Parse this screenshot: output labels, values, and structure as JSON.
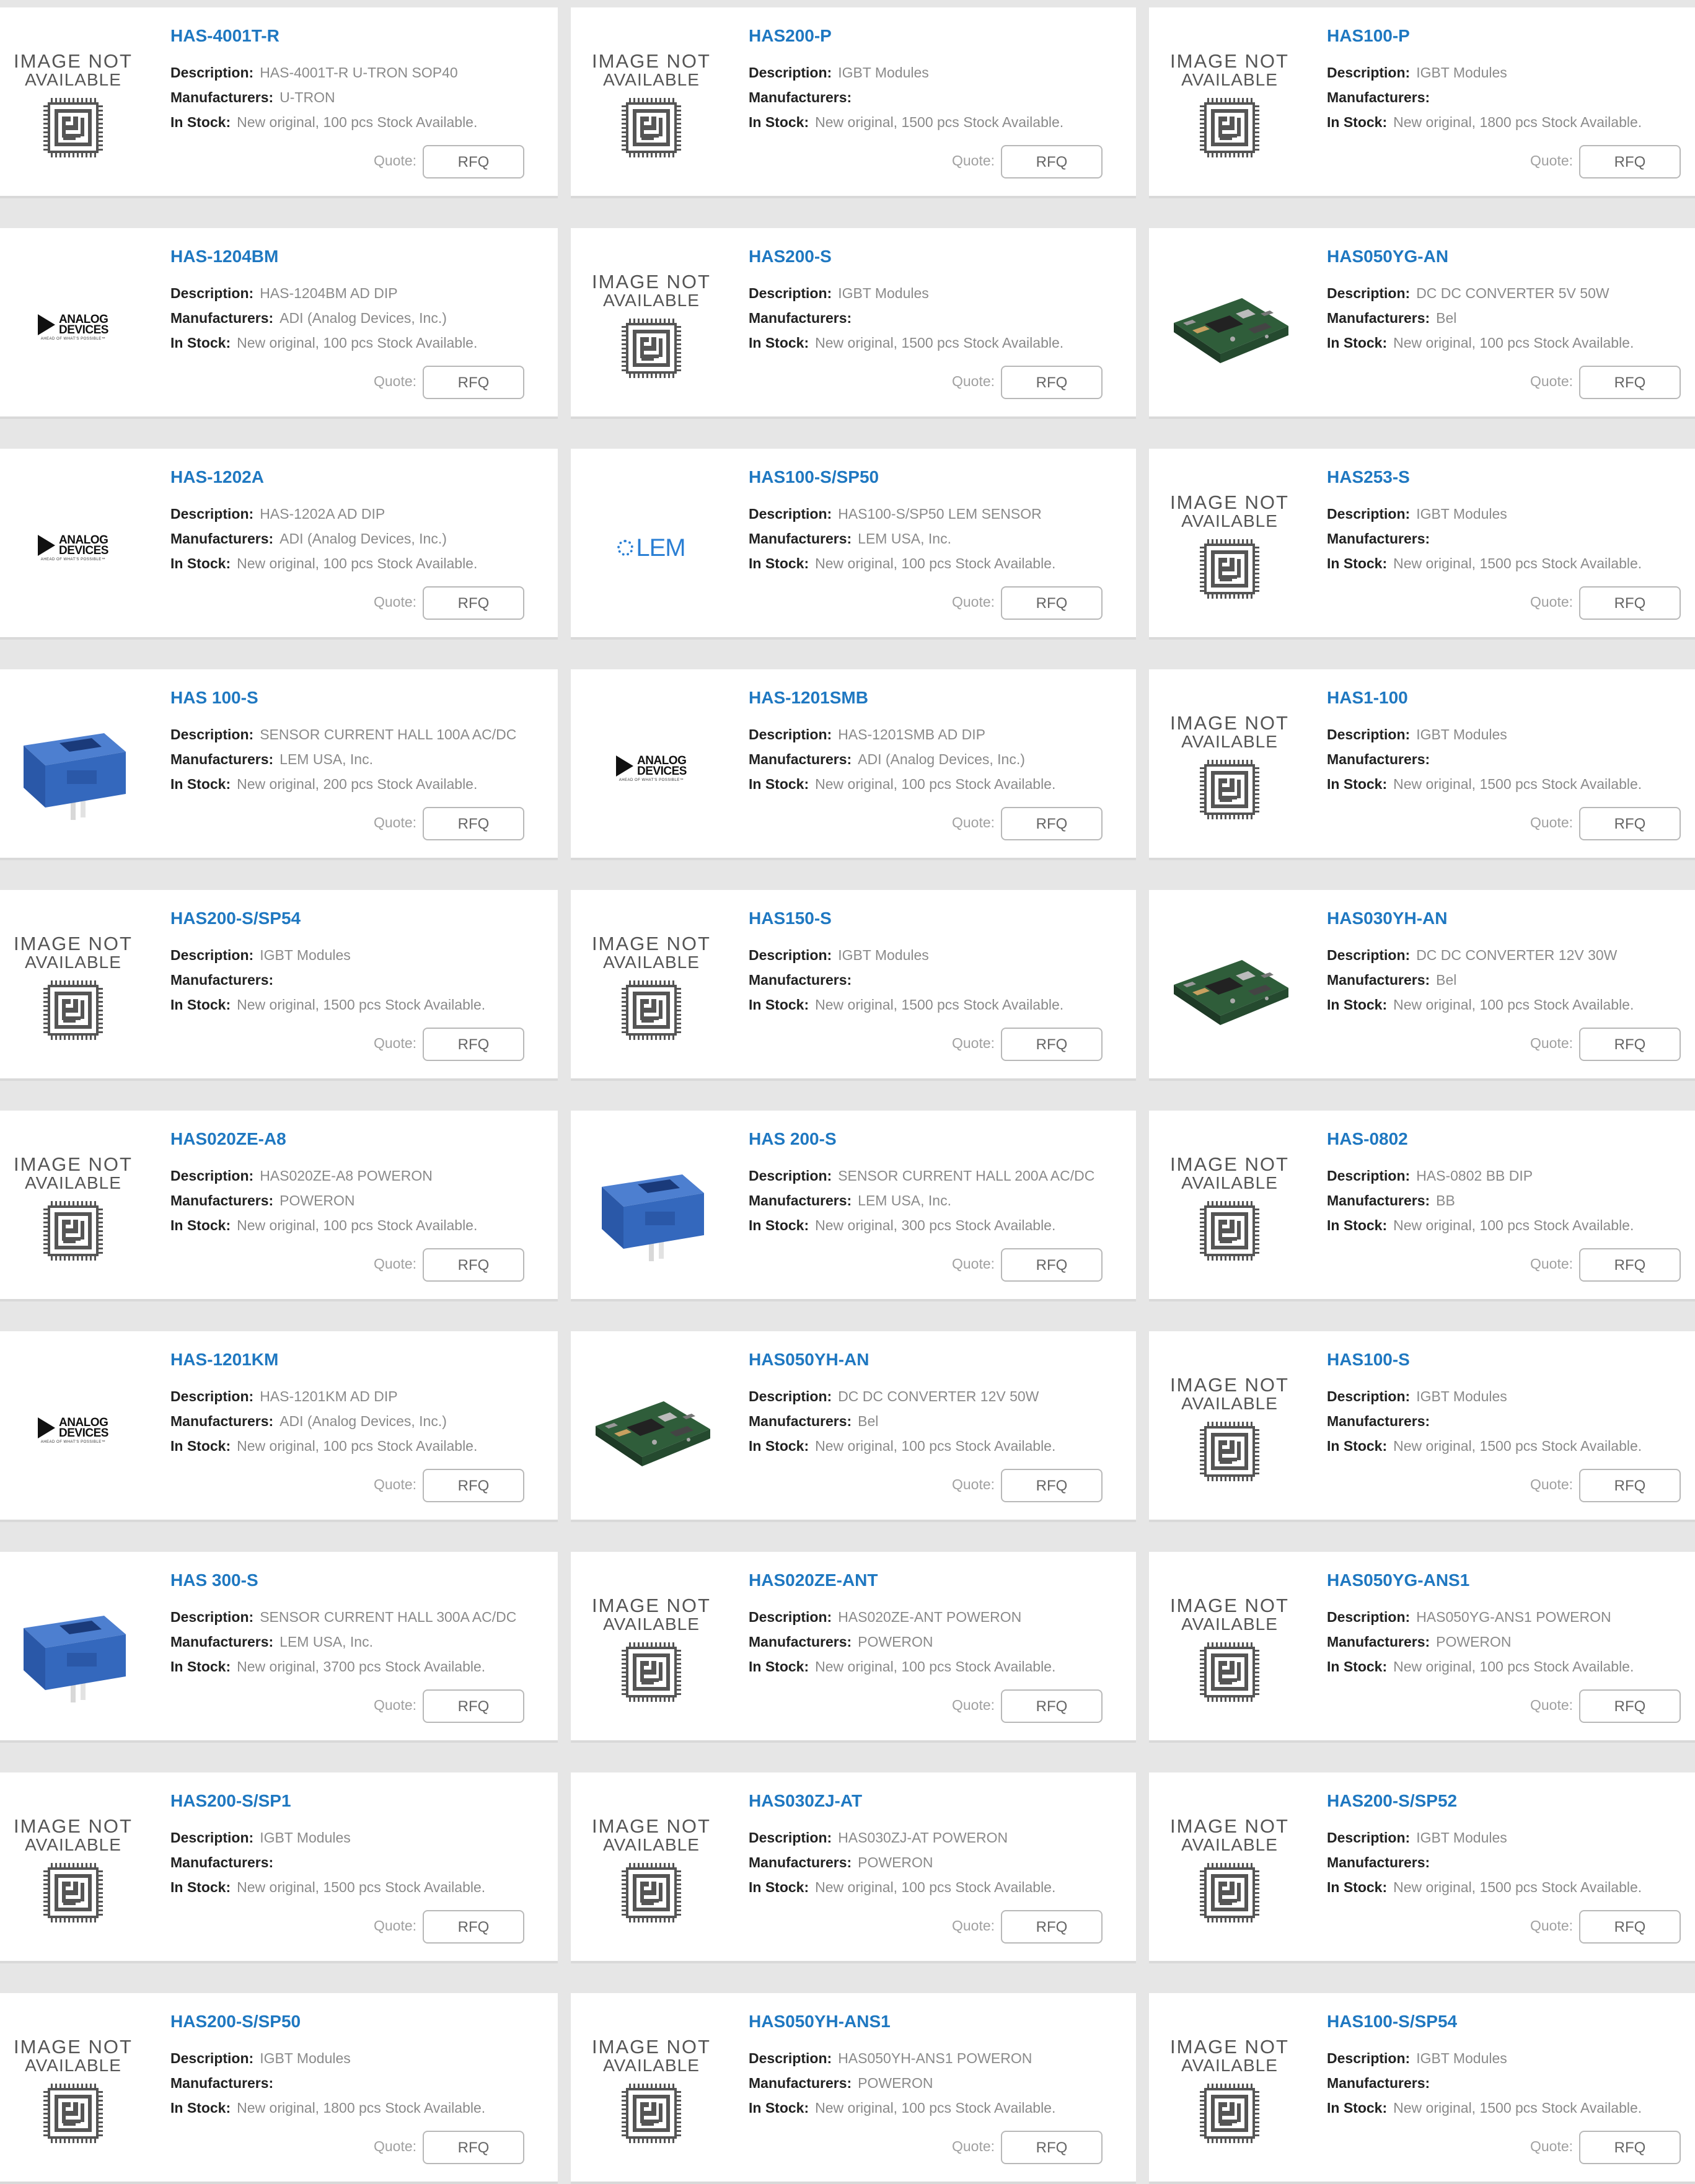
{
  "common": {
    "description_label": "Description:",
    "manufacturers_label": "Manufacturers:",
    "in_stock_label": "In Stock:",
    "quote_label": "Quote:",
    "rfq_label": "RFQ",
    "placeholder_line1": "IMAGE NOT",
    "placeholder_line2": "AVAILABLE",
    "adi_logo_lines": [
      "ANALOG",
      "DEVICES"
    ],
    "adi_tagline": "AHEAD OF WHAT'S POSSIBLE™",
    "lem_logo": "LEM"
  },
  "colors": {
    "title_link": "#1f78c1",
    "sensor_blue": "#2d64b4",
    "pcb_green": "#2f5d3a"
  },
  "products": [
    {
      "title": "HAS-4001T-R",
      "description": "HAS-4001T-R U-TRON SOP40",
      "manufacturer": "U-TRON",
      "stock": "New original, 100 pcs Stock Available.",
      "image": "placeholder"
    },
    {
      "title": "HAS200-P",
      "description": "IGBT Modules",
      "manufacturer": "",
      "stock": "New original, 1500 pcs Stock Available.",
      "image": "placeholder"
    },
    {
      "title": "HAS100-P",
      "description": "IGBT Modules",
      "manufacturer": "",
      "stock": "New original, 1800 pcs Stock Available.",
      "image": "placeholder"
    },
    {
      "title": "HAS-1204BM",
      "description": "HAS-1204BM AD DIP",
      "manufacturer": "ADI (Analog Devices, Inc.)",
      "stock": "New original, 100 pcs Stock Available.",
      "image": "adi"
    },
    {
      "title": "HAS200-S",
      "description": "IGBT Modules",
      "manufacturer": "",
      "stock": "New original, 1500 pcs Stock Available.",
      "image": "placeholder"
    },
    {
      "title": "HAS050YG-AN",
      "description": "DC DC CONVERTER 5V 50W",
      "manufacturer": "Bel",
      "stock": "New original, 100 pcs Stock Available.",
      "image": "pcb"
    },
    {
      "title": "HAS-1202A",
      "description": "HAS-1202A AD DIP",
      "manufacturer": "ADI (Analog Devices, Inc.)",
      "stock": "New original, 100 pcs Stock Available.",
      "image": "adi"
    },
    {
      "title": "HAS100-S/SP50",
      "description": "HAS100-S/SP50 LEM SENSOR",
      "manufacturer": "LEM USA, Inc.",
      "stock": "New original, 100 pcs Stock Available.",
      "image": "lem"
    },
    {
      "title": "HAS253-S",
      "description": "IGBT Modules",
      "manufacturer": "",
      "stock": "New original, 1500 pcs Stock Available.",
      "image": "placeholder"
    },
    {
      "title": "HAS 100-S",
      "description": "SENSOR CURRENT HALL 100A AC/DC",
      "manufacturer": "LEM USA, Inc.",
      "stock": "New original, 200 pcs Stock Available.",
      "image": "sensor"
    },
    {
      "title": "HAS-1201SMB",
      "description": "HAS-1201SMB AD DIP",
      "manufacturer": "ADI (Analog Devices, Inc.)",
      "stock": "New original, 100 pcs Stock Available.",
      "image": "adi"
    },
    {
      "title": "HAS1-100",
      "description": "IGBT Modules",
      "manufacturer": "",
      "stock": "New original, 1500 pcs Stock Available.",
      "image": "placeholder"
    },
    {
      "title": "HAS200-S/SP54",
      "description": "IGBT Modules",
      "manufacturer": "",
      "stock": "New original, 1500 pcs Stock Available.",
      "image": "placeholder"
    },
    {
      "title": "HAS150-S",
      "description": "IGBT Modules",
      "manufacturer": "",
      "stock": "New original, 1500 pcs Stock Available.",
      "image": "placeholder"
    },
    {
      "title": "HAS030YH-AN",
      "description": "DC DC CONVERTER 12V 30W",
      "manufacturer": "Bel",
      "stock": "New original, 100 pcs Stock Available.",
      "image": "pcb"
    },
    {
      "title": "HAS020ZE-A8",
      "description": "HAS020ZE-A8 POWERON",
      "manufacturer": "POWERON",
      "stock": "New original, 100 pcs Stock Available.",
      "image": "placeholder"
    },
    {
      "title": "HAS 200-S",
      "description": "SENSOR CURRENT HALL 200A AC/DC",
      "manufacturer": "LEM USA, Inc.",
      "stock": "New original, 300 pcs Stock Available.",
      "image": "sensor"
    },
    {
      "title": "HAS-0802",
      "description": "HAS-0802 BB DIP",
      "manufacturer": "BB",
      "stock": "New original, 100 pcs Stock Available.",
      "image": "placeholder"
    },
    {
      "title": "HAS-1201KM",
      "description": "HAS-1201KM AD DIP",
      "manufacturer": "ADI (Analog Devices, Inc.)",
      "stock": "New original, 100 pcs Stock Available.",
      "image": "adi"
    },
    {
      "title": "HAS050YH-AN",
      "description": "DC DC CONVERTER 12V 50W",
      "manufacturer": "Bel",
      "stock": "New original, 100 pcs Stock Available.",
      "image": "pcb"
    },
    {
      "title": "HAS100-S",
      "description": "IGBT Modules",
      "manufacturer": "",
      "stock": "New original, 1500 pcs Stock Available.",
      "image": "placeholder"
    },
    {
      "title": "HAS 300-S",
      "description": "SENSOR CURRENT HALL 300A AC/DC",
      "manufacturer": "LEM USA, Inc.",
      "stock": "New original, 3700 pcs Stock Available.",
      "image": "sensor"
    },
    {
      "title": "HAS020ZE-ANT",
      "description": "HAS020ZE-ANT POWERON",
      "manufacturer": "POWERON",
      "stock": "New original, 100 pcs Stock Available.",
      "image": "placeholder"
    },
    {
      "title": "HAS050YG-ANS1",
      "description": "HAS050YG-ANS1 POWERON",
      "manufacturer": "POWERON",
      "stock": "New original, 100 pcs Stock Available.",
      "image": "placeholder"
    },
    {
      "title": "HAS200-S/SP1",
      "description": "IGBT Modules",
      "manufacturer": "",
      "stock": "New original, 1500 pcs Stock Available.",
      "image": "placeholder"
    },
    {
      "title": "HAS030ZJ-AT",
      "description": "HAS030ZJ-AT POWERON",
      "manufacturer": "POWERON",
      "stock": "New original, 100 pcs Stock Available.",
      "image": "placeholder"
    },
    {
      "title": "HAS200-S/SP52",
      "description": "IGBT Modules",
      "manufacturer": "",
      "stock": "New original, 1500 pcs Stock Available.",
      "image": "placeholder"
    },
    {
      "title": "HAS200-S/SP50",
      "description": "IGBT Modules",
      "manufacturer": "",
      "stock": "New original, 1800 pcs Stock Available.",
      "image": "placeholder"
    },
    {
      "title": "HAS050YH-ANS1",
      "description": "HAS050YH-ANS1 POWERON",
      "manufacturer": "POWERON",
      "stock": "New original, 100 pcs Stock Available.",
      "image": "placeholder"
    },
    {
      "title": "HAS100-S/SP54",
      "description": "IGBT Modules",
      "manufacturer": "",
      "stock": "New original, 1500 pcs Stock Available.",
      "image": "placeholder"
    }
  ]
}
